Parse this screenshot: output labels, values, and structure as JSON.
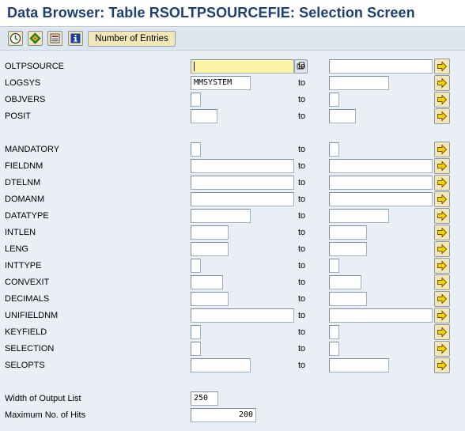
{
  "window": {
    "title": "Data Browser: Table RSOLTPSOURCEFIE: Selection Screen"
  },
  "toolbar": {
    "icons": [
      "execute-icon",
      "selection-options-icon",
      "save-variant-icon",
      "info-icon"
    ],
    "number_of_entries_label": "Number of Entries"
  },
  "colors": {
    "title": "#1c3f75",
    "background": "#eaeff5",
    "button_face": "#f3e7b8",
    "focused_field": "#fdf3a4",
    "arrow": "#f5d200"
  },
  "to_label": "to",
  "fields": [
    {
      "name": "OLTPSOURCE",
      "low": "",
      "high": "",
      "focused": true
    },
    {
      "name": "LOGSYS",
      "low": "MMSYSTEM",
      "high": ""
    },
    {
      "name": "OBJVERS",
      "low": "",
      "high": ""
    },
    {
      "name": "POSIT",
      "low": "",
      "high": ""
    },
    {
      "name": "MANDATORY",
      "low": "",
      "high": ""
    },
    {
      "name": "FIELDNM",
      "low": "",
      "high": ""
    },
    {
      "name": "DTELNM",
      "low": "",
      "high": ""
    },
    {
      "name": "DOMANM",
      "low": "",
      "high": ""
    },
    {
      "name": "DATATYPE",
      "low": "",
      "high": ""
    },
    {
      "name": "INTLEN",
      "low": "",
      "high": ""
    },
    {
      "name": "LENG",
      "low": "",
      "high": ""
    },
    {
      "name": "INTTYPE",
      "low": "",
      "high": ""
    },
    {
      "name": "CONVEXIT",
      "low": "",
      "high": ""
    },
    {
      "name": "DECIMALS",
      "low": "",
      "high": ""
    },
    {
      "name": "UNIFIELDNM",
      "low": "",
      "high": ""
    },
    {
      "name": "KEYFIELD",
      "low": "",
      "high": ""
    },
    {
      "name": "SELECTION",
      "low": "",
      "high": ""
    },
    {
      "name": "SELOPTS",
      "low": "",
      "high": ""
    }
  ],
  "output": {
    "width_label": "Width of Output List",
    "width_value": "250",
    "max_hits_label": "Maximum No. of Hits",
    "max_hits_value": "200"
  }
}
